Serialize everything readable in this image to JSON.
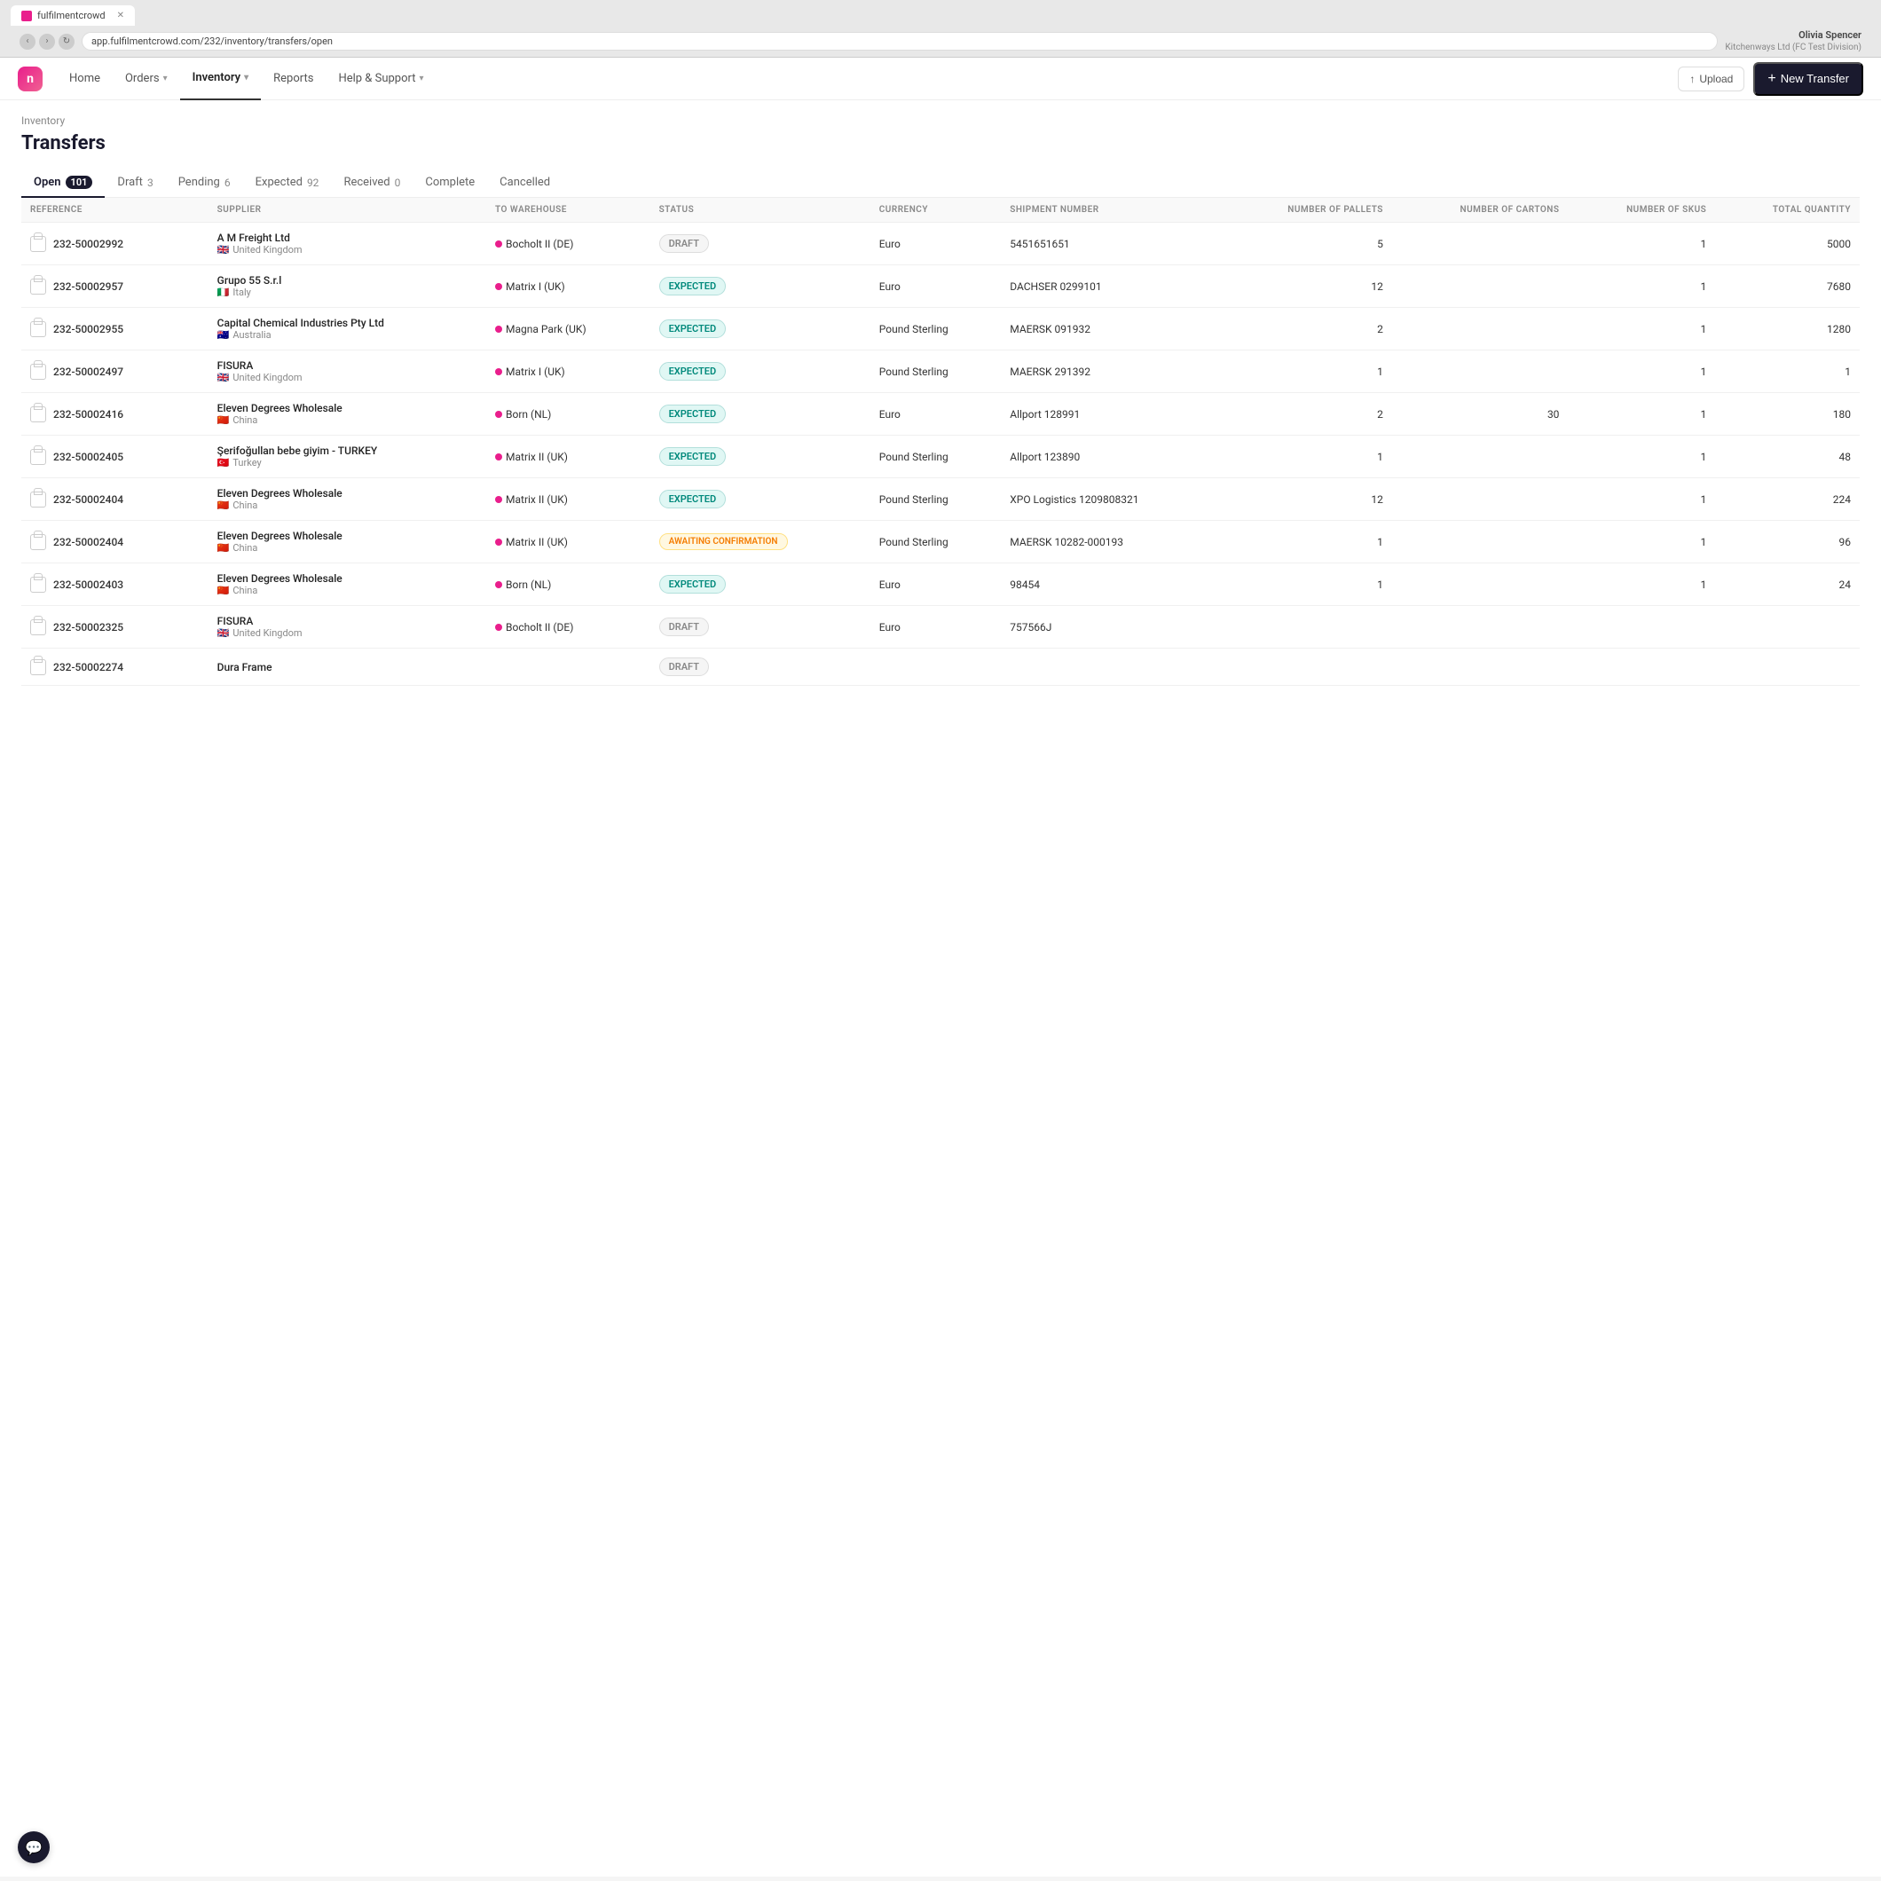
{
  "browser": {
    "tab_title": "fulfilmentcrowd",
    "url": "app.fulfilmentcrowd.com/232/inventory/transfers/open",
    "user_name": "Olivia Spencer",
    "user_company": "Kitchenways Ltd (FC Test Division)"
  },
  "nav": {
    "logo_letter": "n",
    "items": [
      {
        "label": "Home",
        "active": false,
        "has_dropdown": false
      },
      {
        "label": "Orders",
        "active": false,
        "has_dropdown": true
      },
      {
        "label": "Inventory",
        "active": true,
        "has_dropdown": true
      },
      {
        "label": "Reports",
        "active": false,
        "has_dropdown": false
      },
      {
        "label": "Help & Support",
        "active": false,
        "has_dropdown": true
      }
    ],
    "upload_label": "Upload",
    "new_transfer_label": "New Transfer"
  },
  "page": {
    "breadcrumb": "Inventory",
    "title": "Transfers"
  },
  "status_tabs": [
    {
      "label": "Open",
      "count": 101,
      "active": true
    },
    {
      "label": "Draft",
      "count": 3,
      "active": false
    },
    {
      "label": "Pending",
      "count": 6,
      "active": false
    },
    {
      "label": "Expected",
      "count": 92,
      "active": false
    },
    {
      "label": "Received",
      "count": 0,
      "active": false
    },
    {
      "label": "Complete",
      "count": null,
      "active": false
    },
    {
      "label": "Cancelled",
      "count": null,
      "active": false
    }
  ],
  "table": {
    "columns": [
      {
        "label": "Reference",
        "key": "reference"
      },
      {
        "label": "Supplier",
        "key": "supplier"
      },
      {
        "label": "To Warehouse",
        "key": "warehouse"
      },
      {
        "label": "Status",
        "key": "status"
      },
      {
        "label": "Currency",
        "key": "currency"
      },
      {
        "label": "Shipment Number",
        "key": "shipment"
      },
      {
        "label": "Number of Pallets",
        "key": "pallets",
        "right": true
      },
      {
        "label": "Number of Cartons",
        "key": "cartons",
        "right": true
      },
      {
        "label": "Number of SKUs",
        "key": "skus",
        "right": true
      },
      {
        "label": "Total Quantity",
        "key": "total_qty",
        "right": true
      }
    ],
    "rows": [
      {
        "reference": "232-50002992",
        "supplier_name": "A M Freight Ltd",
        "supplier_country": "United Kingdom",
        "supplier_flag": "gb",
        "warehouse": "Bocholt II (DE)",
        "status": "DRAFT",
        "status_type": "draft",
        "currency": "Euro",
        "shipment": "5451651651",
        "pallets": "5",
        "cartons": "",
        "skus": "1",
        "total_qty": "5000"
      },
      {
        "reference": "232-50002957",
        "supplier_name": "Grupo 55 S.r.l",
        "supplier_country": "Italy",
        "supplier_flag": "it",
        "warehouse": "Matrix I (UK)",
        "status": "EXPECTED",
        "status_type": "expected",
        "currency": "Euro",
        "shipment": "DACHSER 0299101",
        "pallets": "12",
        "cartons": "",
        "skus": "1",
        "total_qty": "7680"
      },
      {
        "reference": "232-50002955",
        "supplier_name": "Capital Chemical Industries Pty Ltd",
        "supplier_country": "Australia",
        "supplier_flag": "au",
        "warehouse": "Magna Park (UK)",
        "status": "EXPECTED",
        "status_type": "expected",
        "currency": "Pound Sterling",
        "shipment": "MAERSK 091932",
        "pallets": "2",
        "cartons": "",
        "skus": "1",
        "total_qty": "1280"
      },
      {
        "reference": "232-50002497",
        "supplier_name": "FISURA",
        "supplier_country": "United Kingdom",
        "supplier_flag": "gb",
        "warehouse": "Matrix I (UK)",
        "status": "EXPECTED",
        "status_type": "expected",
        "currency": "Pound Sterling",
        "shipment": "MAERSK 291392",
        "pallets": "1",
        "cartons": "",
        "skus": "1",
        "total_qty": "1"
      },
      {
        "reference": "232-50002416",
        "supplier_name": "Eleven Degrees Wholesale",
        "supplier_country": "China",
        "supplier_flag": "cn",
        "warehouse": "Born (NL)",
        "status": "EXPECTED",
        "status_type": "expected",
        "currency": "Euro",
        "shipment": "Allport 128991",
        "pallets": "2",
        "cartons": "30",
        "skus": "1",
        "total_qty": "180"
      },
      {
        "reference": "232-50002405",
        "supplier_name": "Şerifoğullan bebe giyim - TURKEY",
        "supplier_country": "Turkey",
        "supplier_flag": "tr",
        "warehouse": "Matrix II (UK)",
        "status": "EXPECTED",
        "status_type": "expected",
        "currency": "Pound Sterling",
        "shipment": "Allport 123890",
        "pallets": "1",
        "cartons": "",
        "skus": "1",
        "total_qty": "48"
      },
      {
        "reference": "232-50002404",
        "supplier_name": "Eleven Degrees Wholesale",
        "supplier_country": "China",
        "supplier_flag": "cn",
        "warehouse": "Matrix II (UK)",
        "status": "EXPECTED",
        "status_type": "expected",
        "currency": "Pound Sterling",
        "shipment": "XPO Logistics 1209808321",
        "pallets": "12",
        "cartons": "",
        "skus": "1",
        "total_qty": "224"
      },
      {
        "reference": "232-50002404",
        "supplier_name": "Eleven Degrees Wholesale",
        "supplier_country": "China",
        "supplier_flag": "cn",
        "warehouse": "Matrix II (UK)",
        "status": "AWAITING CONFIRMATION",
        "status_type": "awaiting",
        "currency": "Pound Sterling",
        "shipment": "MAERSK 10282-000193",
        "pallets": "1",
        "cartons": "",
        "skus": "1",
        "total_qty": "96"
      },
      {
        "reference": "232-50002403",
        "supplier_name": "Eleven Degrees Wholesale",
        "supplier_country": "China",
        "supplier_flag": "cn",
        "warehouse": "Born (NL)",
        "status": "EXPECTED",
        "status_type": "expected",
        "currency": "Euro",
        "shipment": "98454",
        "pallets": "1",
        "cartons": "",
        "skus": "1",
        "total_qty": "24"
      },
      {
        "reference": "232-50002325",
        "supplier_name": "FISURA",
        "supplier_country": "United Kingdom",
        "supplier_flag": "gb",
        "warehouse": "Bocholt II (DE)",
        "status": "DRAFT",
        "status_type": "draft",
        "currency": "Euro",
        "shipment": "757566J",
        "pallets": "",
        "cartons": "",
        "skus": "",
        "total_qty": ""
      },
      {
        "reference": "232-50002274",
        "supplier_name": "Dura Frame",
        "supplier_country": "",
        "supplier_flag": "",
        "warehouse": "",
        "status": "DRAFT",
        "status_type": "draft",
        "currency": "",
        "shipment": "",
        "pallets": "",
        "cartons": "",
        "skus": "",
        "total_qty": ""
      }
    ]
  }
}
